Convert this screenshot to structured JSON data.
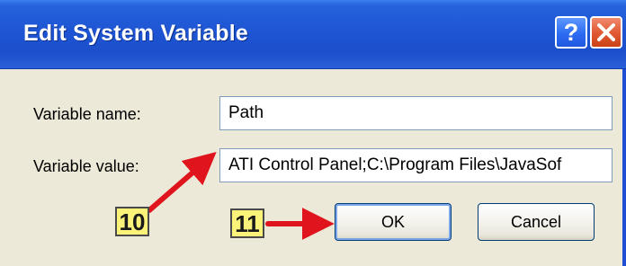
{
  "dialog": {
    "title": "Edit System Variable",
    "help_glyph": "?",
    "close_icon": "close-icon"
  },
  "form": {
    "name_label": "Variable name:",
    "name_value": "Path",
    "value_label": "Variable value:",
    "value_value": "ATI Control Panel;C:\\Program Files\\JavaSof"
  },
  "buttons": {
    "ok_label": "OK",
    "cancel_label": "Cancel"
  },
  "annotations": {
    "step_a": "10",
    "step_b": "11",
    "arrow_color": "#e0141c",
    "badge_color": "#fbf27a"
  }
}
